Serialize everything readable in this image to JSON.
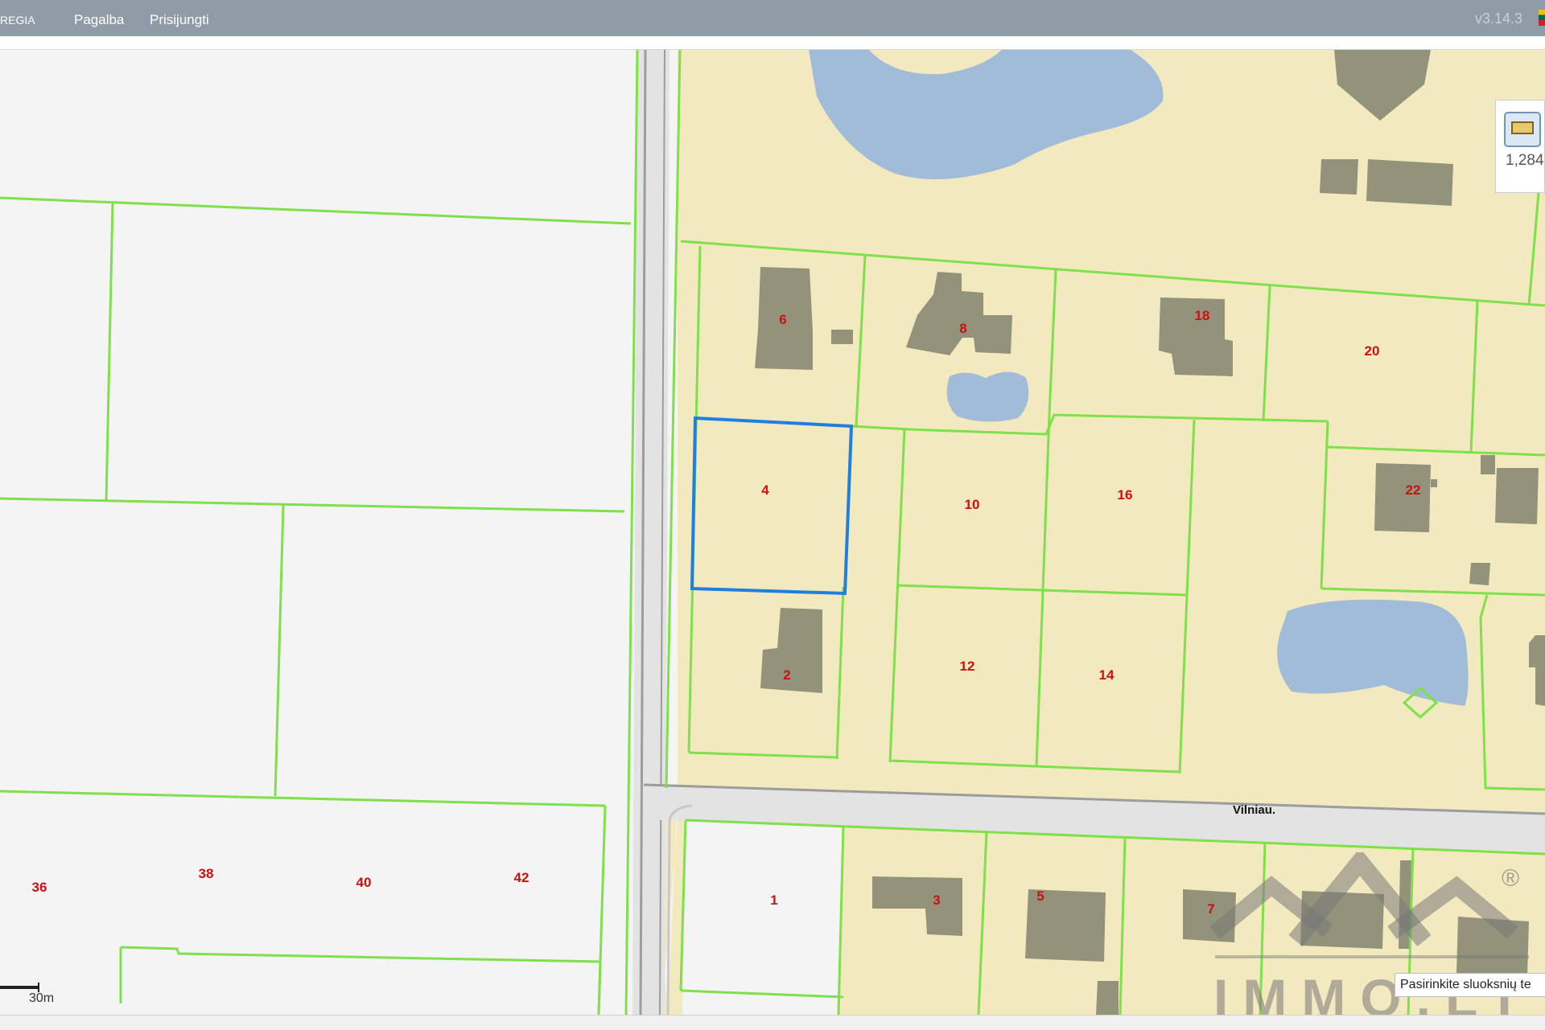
{
  "header": {
    "brand": "REGIA",
    "menu": [
      "Pagalba",
      "Prisijungti"
    ],
    "version": "v3.14.3"
  },
  "map": {
    "street_name": "Vilniau.",
    "scale_label": "30m",
    "selected_plot": "4",
    "plots": [
      {
        "id": "p6",
        "label": "6"
      },
      {
        "id": "p8",
        "label": "8"
      },
      {
        "id": "p18",
        "label": "18"
      },
      {
        "id": "p20",
        "label": "20"
      },
      {
        "id": "p4",
        "label": "4"
      },
      {
        "id": "p10",
        "label": "10"
      },
      {
        "id": "p16",
        "label": "16"
      },
      {
        "id": "p22",
        "label": "22"
      },
      {
        "id": "p2",
        "label": "2"
      },
      {
        "id": "p12",
        "label": "12"
      },
      {
        "id": "p14",
        "label": "14"
      },
      {
        "id": "p1",
        "label": "1"
      },
      {
        "id": "p3",
        "label": "3"
      },
      {
        "id": "p5",
        "label": "5"
      },
      {
        "id": "p7",
        "label": "7"
      },
      {
        "id": "p36",
        "label": "36"
      },
      {
        "id": "p38",
        "label": "38"
      },
      {
        "id": "p40",
        "label": "40"
      },
      {
        "id": "p42",
        "label": "42"
      }
    ],
    "colors": {
      "parcel_fill": "#f3e9bf",
      "parcel_border": "#7ee04a",
      "building": "#93927a",
      "water": "#a0bcd9",
      "selection": "#1f7fe0",
      "label": "#cc1010"
    }
  },
  "legend": {
    "icon": "layer-tile-icon",
    "count": "1,284"
  },
  "layer_hint": "Pasirinkite sluoksnių te",
  "watermark": {
    "text": "IMMO.LT",
    "symbol": "®"
  }
}
